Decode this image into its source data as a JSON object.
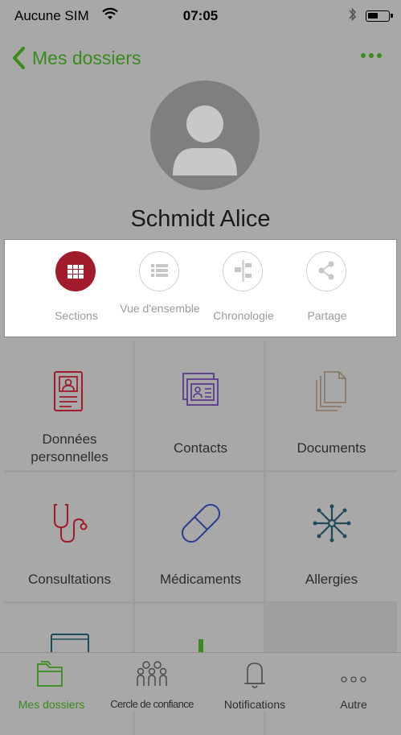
{
  "status_bar": {
    "carrier": "Aucune SIM",
    "time": "07:05"
  },
  "nav": {
    "back_label": "Mes dossiers"
  },
  "profile": {
    "name": "Schmidt Alice"
  },
  "view_tabs": [
    {
      "label": "Sections"
    },
    {
      "label": "Vue d'ensemble"
    },
    {
      "label": "Chronologie"
    },
    {
      "label": "Partage"
    }
  ],
  "sections": [
    {
      "label": "Données personnelles",
      "icon": "profile-card-icon",
      "color": "#a01c2c"
    },
    {
      "label": "Contacts",
      "icon": "contact-cards-icon",
      "color": "#5b3a8c"
    },
    {
      "label": "Documents",
      "icon": "documents-icon",
      "color": "#8a7a6a"
    },
    {
      "label": "Consultations",
      "icon": "stethoscope-icon",
      "color": "#a01c2c"
    },
    {
      "label": "Médicaments",
      "icon": "pill-icon",
      "color": "#2a3d8f"
    },
    {
      "label": "Allergies",
      "icon": "allergen-icon",
      "color": "#1f4a5c"
    }
  ],
  "tab_bar": [
    {
      "label": "Mes dossiers",
      "icon": "folder-icon"
    },
    {
      "label": "Cercle de confiance",
      "icon": "people-icon"
    },
    {
      "label": "Notifications",
      "icon": "bell-icon"
    },
    {
      "label": "Autre",
      "icon": "more-icon"
    }
  ],
  "colors": {
    "accent": "#3c8a1f",
    "active_tab": "#a01c2c"
  }
}
